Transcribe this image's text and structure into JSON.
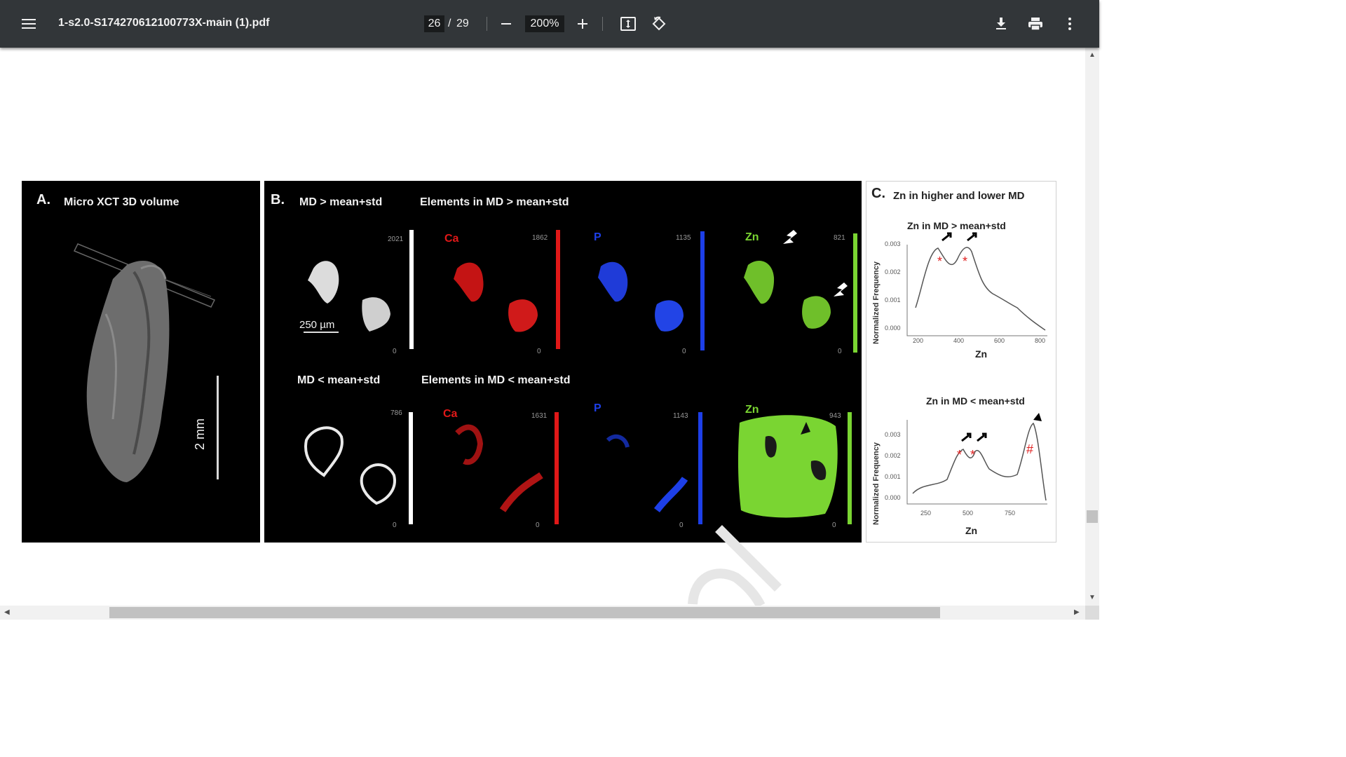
{
  "toolbar": {
    "title": "1-s2.0-S174270612100773X-main (1).pdf",
    "page_current": "26",
    "page_separator": "/",
    "page_total": "29",
    "zoom": "200%",
    "icons": [
      "menu-icon",
      "minus-icon",
      "plus-icon",
      "fit-page-icon",
      "rotate-icon",
      "download-icon",
      "print-icon",
      "more-vert-icon"
    ]
  },
  "figure": {
    "panel_a": {
      "letter": "A.",
      "title": "Micro XCT 3D volume",
      "scale_label": "2 mm"
    },
    "panel_b": {
      "letter": "B.",
      "top_left_title": "MD > mean+std",
      "top_right_title": "Elements in MD > mean+std",
      "bottom_left_title": "MD < mean+std",
      "bottom_right_title": "Elements in MD < mean+std",
      "scale_bar": "250 µm",
      "element_ca": "Ca",
      "element_p": "P",
      "element_zn": "Zn",
      "top_max": [
        "2021",
        "1862",
        "1135",
        "821"
      ],
      "bottom_max": [
        "786",
        "1631",
        "1143",
        "943"
      ],
      "min_label": "0",
      "colors": {
        "ca": "#e01818",
        "p": "#1d3fe8",
        "zn": "#7ad532"
      }
    },
    "panel_c": {
      "letter": "C.",
      "title": "Zn in higher and lower MD",
      "top_chart": {
        "title": "Zn in MD > mean+std",
        "ylabel": "Normalized Frequency",
        "xlabel": "Zn",
        "yticks": [
          "0.003",
          "0.002",
          "0.001",
          "0.000"
        ],
        "xticks": [
          "200",
          "400",
          "600",
          "800"
        ]
      },
      "bottom_chart": {
        "title": "Zn in MD < mean+std",
        "ylabel": "Normalized Frequency",
        "xlabel": "Zn",
        "yticks": [
          "0.003",
          "0.002",
          "0.001",
          "0.000"
        ],
        "xticks": [
          "250",
          "500",
          "750"
        ]
      },
      "marker_star": "*",
      "marker_hash": "#"
    }
  }
}
